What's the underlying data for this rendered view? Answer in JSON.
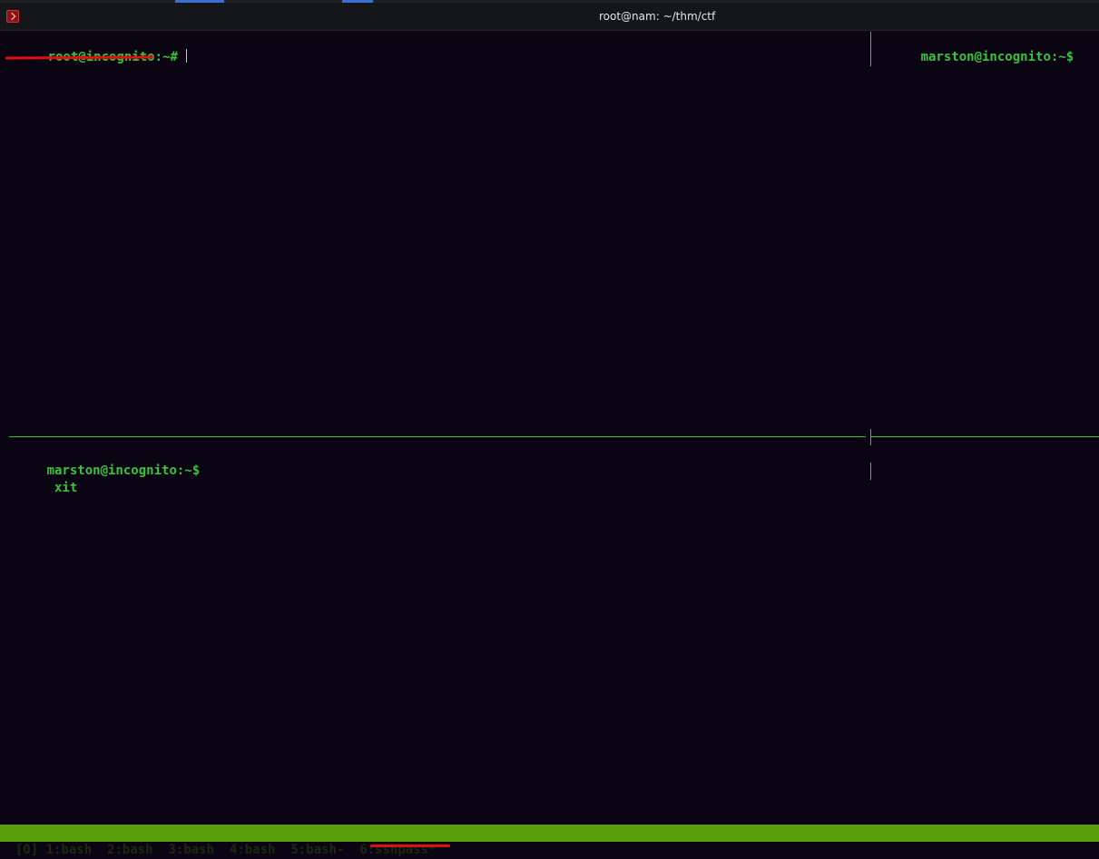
{
  "window": {
    "title": "root@nam: ~/thm/ctf"
  },
  "panes": {
    "top_left": {
      "prompt": "root@incognito:~#"
    },
    "top_right": {
      "prompt": "marston@incognito:~$"
    },
    "bottom_left": {
      "prompt": "marston@incognito:~$",
      "output": " xit"
    }
  },
  "statusbar": {
    "session": "[0]",
    "windows": [
      {
        "label": "1:bash"
      },
      {
        "label": "2:bash"
      },
      {
        "label": "3:bash"
      },
      {
        "label": "4:bash"
      },
      {
        "label": "5:bash-"
      },
      {
        "label": "6:sshpass*"
      }
    ]
  },
  "colors": {
    "terminal_bg": "#0b0412",
    "prompt_green": "#3ac43a",
    "status_bar": "#5a9e0c",
    "annotation": "#e01010"
  }
}
